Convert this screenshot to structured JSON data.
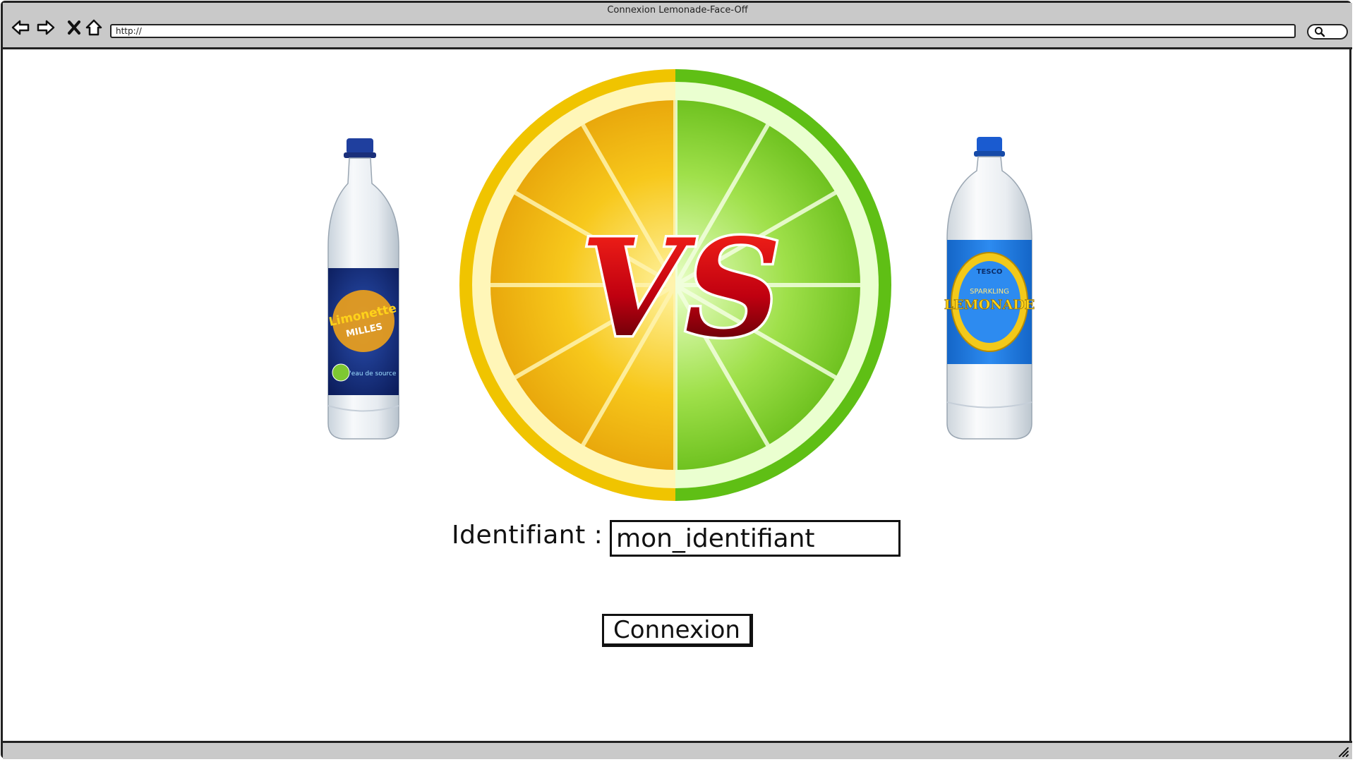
{
  "window": {
    "title": "Connexion Lemonade-Face-Off",
    "url": "http://"
  },
  "icons": {
    "back": "back-arrow-icon",
    "forward": "forward-arrow-icon",
    "close": "close-icon",
    "home": "home-icon",
    "search": "search-icon",
    "resize": "resize-grip-icon"
  },
  "colors": {
    "chrome": "#c9c9c9",
    "outline": "#222222",
    "lemon": "#f5c518",
    "lime": "#7ed321",
    "vs_red": "#d0021b"
  },
  "hero": {
    "left_bottle": {
      "brand_line1": "Limonette",
      "brand_line2": "MILLES",
      "tagline": "N'eau de source"
    },
    "right_bottle": {
      "brand_top": "TESCO",
      "brand_line1": "SPARKLING",
      "brand_line2": "LEMONADE"
    },
    "vs_label": "VS"
  },
  "login": {
    "label": "Identifiant :",
    "value": "mon_identifiant",
    "button_label": "Connexion"
  }
}
